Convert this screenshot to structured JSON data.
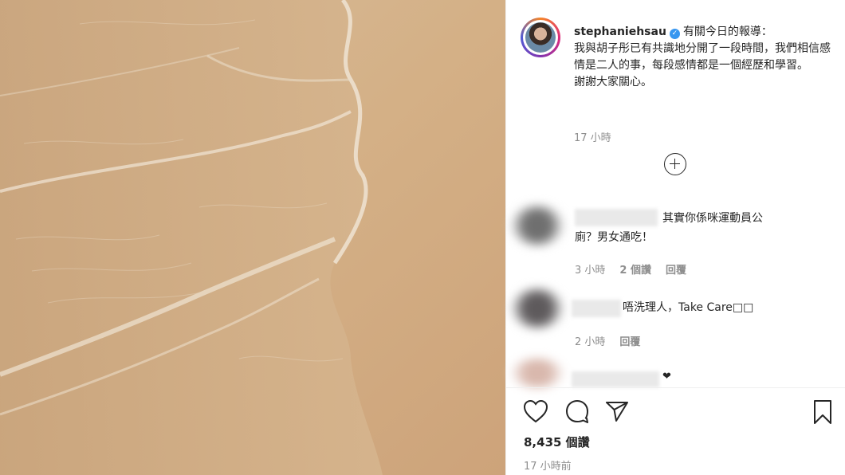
{
  "post": {
    "username": "stephaniehsau",
    "verified_badge": "✓",
    "caption": "有關今日的報導：\n我與胡子彤已有共識地分開了一段時間，我們相信感情是二人的事，每段感情都是一個經歷和學習。\n謝謝大家關心。",
    "caption_time": "17 小時",
    "load_more_icon": "plus-circle-icon",
    "likes": "8,435 個讚",
    "posted_time": "17 小時前"
  },
  "comments": [
    {
      "text": "其實你係咪運動員公\n廁？男女通吃！",
      "time": "3 小時",
      "likes": "2 個讚",
      "reply": "回覆"
    },
    {
      "text": "唔洗理人，Take Care□□",
      "time": "2 小時",
      "reply": "回覆"
    },
    {
      "text": "❤"
    }
  ],
  "actions": {
    "like_icon": "heart-icon",
    "comment_icon": "comment-icon",
    "share_icon": "paper-plane-icon",
    "save_icon": "bookmark-icon"
  },
  "colors": {
    "sand": "#d7b48b",
    "verified": "#3897f0",
    "muted_text": "#8e8e8e"
  }
}
